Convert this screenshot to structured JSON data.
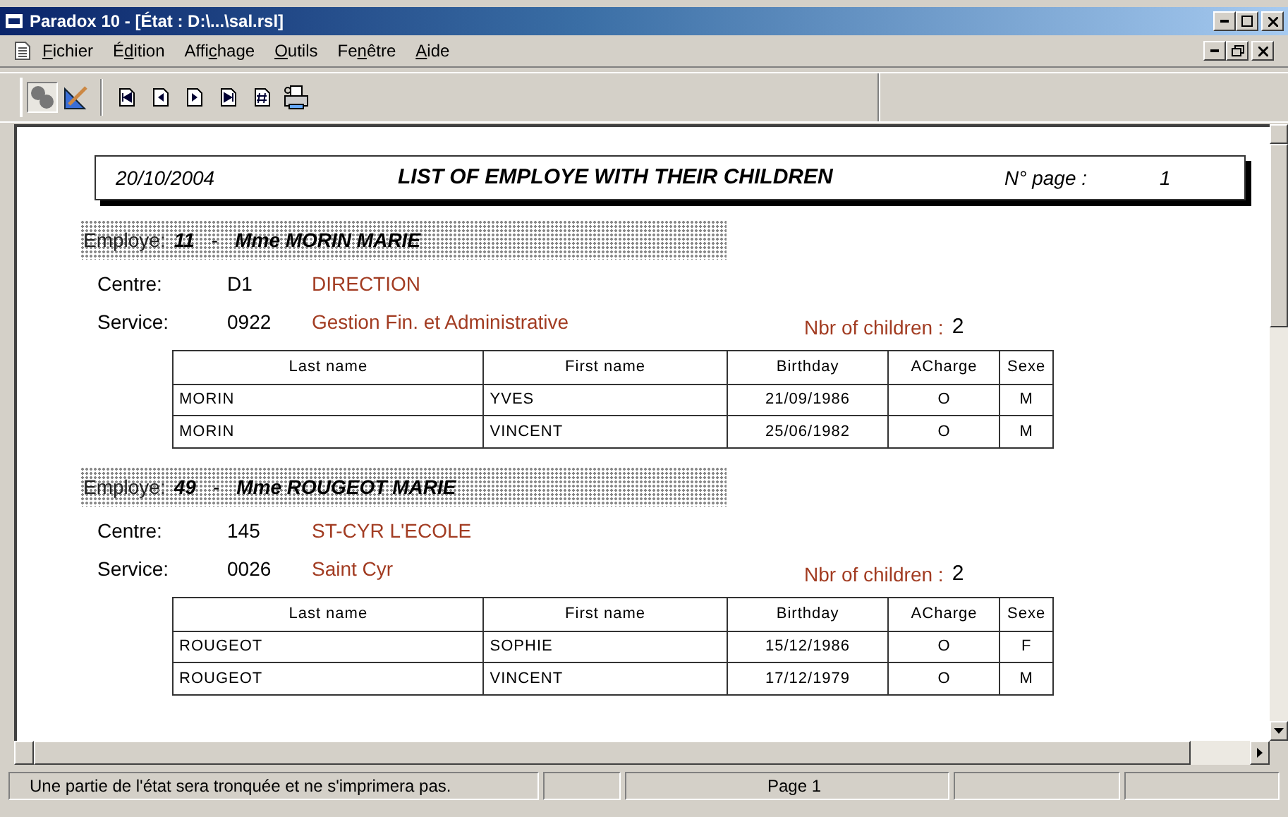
{
  "window": {
    "title": "Paradox 10 - [État : D:\\...\\sal.rsl]"
  },
  "menu": [
    {
      "key": "F",
      "post": "ichier"
    },
    {
      "pre": "É",
      "key": "d",
      "post": "ition"
    },
    {
      "pre": "Affi",
      "key": "c",
      "post": "hage"
    },
    {
      "key": "O",
      "post": "utils"
    },
    {
      "pre": "Fe",
      "key": "n",
      "post": "être"
    },
    {
      "key": "A",
      "post": "ide"
    }
  ],
  "toolbar": [
    {
      "kind": "design",
      "selected": true
    },
    {
      "kind": "edit",
      "selected": false
    },
    {
      "kind": "first",
      "selected": false
    },
    {
      "kind": "prev",
      "selected": false
    },
    {
      "kind": "next",
      "selected": false
    },
    {
      "kind": "last",
      "selected": false
    },
    {
      "kind": "goto",
      "selected": false
    },
    {
      "kind": "print",
      "selected": false
    }
  ],
  "report": {
    "date": "20/10/2004",
    "title": "LIST OF EMPLOYE WITH THEIR CHILDREN",
    "page_label": "N° page :",
    "page_number": "1",
    "employees": [
      {
        "label": "Employe:",
        "number": "11",
        "separator": "-",
        "name": "Mme MORIN MARIE",
        "centre_label": "Centre:",
        "centre_code": "D1",
        "centre_name": "DIRECTION",
        "service_label": "Service:",
        "service_code": "0922",
        "service_name": "Gestion Fin. et Administrative",
        "children_label": "Nbr of children :",
        "children_count": "2",
        "columns": [
          "Last name",
          "First name",
          "Birthday",
          "ACharge",
          "Sexe"
        ],
        "rows": [
          [
            "MORIN",
            "YVES",
            "21/09/1986",
            "O",
            "M"
          ],
          [
            "MORIN",
            "VINCENT",
            "25/06/1982",
            "O",
            "M"
          ]
        ]
      },
      {
        "label": "Employe:",
        "number": "49",
        "separator": "-",
        "name": "Mme ROUGEOT MARIE",
        "centre_label": "Centre:",
        "centre_code": "145",
        "centre_name": "ST-CYR L'ECOLE",
        "service_label": "Service:",
        "service_code": "0026",
        "service_name": "Saint Cyr",
        "children_label": "Nbr of children :",
        "children_count": "2",
        "columns": [
          "Last name",
          "First name",
          "Birthday",
          "ACharge",
          "Sexe"
        ],
        "rows": [
          [
            "ROUGEOT",
            "SOPHIE",
            "15/12/1986",
            "O",
            "F"
          ],
          [
            "ROUGEOT",
            "VINCENT",
            "17/12/1979",
            "O",
            "M"
          ]
        ]
      }
    ]
  },
  "status_bar": {
    "message": "Une partie de l'état sera tronquée et ne s'imprimera pas.",
    "page": "Page 1"
  }
}
